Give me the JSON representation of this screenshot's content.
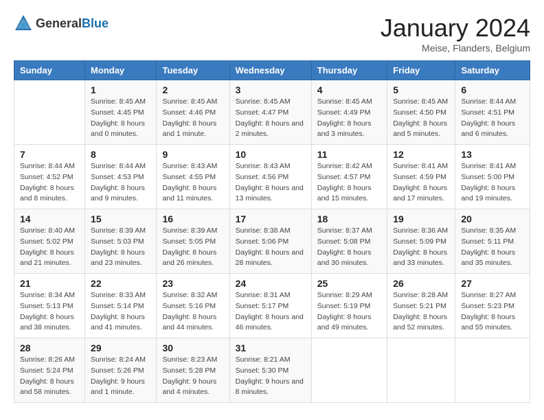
{
  "header": {
    "logo_general": "General",
    "logo_blue": "Blue",
    "month_title": "January 2024",
    "location": "Meise, Flanders, Belgium"
  },
  "days_of_week": [
    "Sunday",
    "Monday",
    "Tuesday",
    "Wednesday",
    "Thursday",
    "Friday",
    "Saturday"
  ],
  "weeks": [
    [
      {
        "day": "",
        "sunrise": "",
        "sunset": "",
        "daylight": ""
      },
      {
        "day": "1",
        "sunrise": "Sunrise: 8:45 AM",
        "sunset": "Sunset: 4:45 PM",
        "daylight": "Daylight: 8 hours and 0 minutes."
      },
      {
        "day": "2",
        "sunrise": "Sunrise: 8:45 AM",
        "sunset": "Sunset: 4:46 PM",
        "daylight": "Daylight: 8 hours and 1 minute."
      },
      {
        "day": "3",
        "sunrise": "Sunrise: 8:45 AM",
        "sunset": "Sunset: 4:47 PM",
        "daylight": "Daylight: 8 hours and 2 minutes."
      },
      {
        "day": "4",
        "sunrise": "Sunrise: 8:45 AM",
        "sunset": "Sunset: 4:49 PM",
        "daylight": "Daylight: 8 hours and 3 minutes."
      },
      {
        "day": "5",
        "sunrise": "Sunrise: 8:45 AM",
        "sunset": "Sunset: 4:50 PM",
        "daylight": "Daylight: 8 hours and 5 minutes."
      },
      {
        "day": "6",
        "sunrise": "Sunrise: 8:44 AM",
        "sunset": "Sunset: 4:51 PM",
        "daylight": "Daylight: 8 hours and 6 minutes."
      }
    ],
    [
      {
        "day": "7",
        "sunrise": "Sunrise: 8:44 AM",
        "sunset": "Sunset: 4:52 PM",
        "daylight": "Daylight: 8 hours and 8 minutes."
      },
      {
        "day": "8",
        "sunrise": "Sunrise: 8:44 AM",
        "sunset": "Sunset: 4:53 PM",
        "daylight": "Daylight: 8 hours and 9 minutes."
      },
      {
        "day": "9",
        "sunrise": "Sunrise: 8:43 AM",
        "sunset": "Sunset: 4:55 PM",
        "daylight": "Daylight: 8 hours and 11 minutes."
      },
      {
        "day": "10",
        "sunrise": "Sunrise: 8:43 AM",
        "sunset": "Sunset: 4:56 PM",
        "daylight": "Daylight: 8 hours and 13 minutes."
      },
      {
        "day": "11",
        "sunrise": "Sunrise: 8:42 AM",
        "sunset": "Sunset: 4:57 PM",
        "daylight": "Daylight: 8 hours and 15 minutes."
      },
      {
        "day": "12",
        "sunrise": "Sunrise: 8:41 AM",
        "sunset": "Sunset: 4:59 PM",
        "daylight": "Daylight: 8 hours and 17 minutes."
      },
      {
        "day": "13",
        "sunrise": "Sunrise: 8:41 AM",
        "sunset": "Sunset: 5:00 PM",
        "daylight": "Daylight: 8 hours and 19 minutes."
      }
    ],
    [
      {
        "day": "14",
        "sunrise": "Sunrise: 8:40 AM",
        "sunset": "Sunset: 5:02 PM",
        "daylight": "Daylight: 8 hours and 21 minutes."
      },
      {
        "day": "15",
        "sunrise": "Sunrise: 8:39 AM",
        "sunset": "Sunset: 5:03 PM",
        "daylight": "Daylight: 8 hours and 23 minutes."
      },
      {
        "day": "16",
        "sunrise": "Sunrise: 8:39 AM",
        "sunset": "Sunset: 5:05 PM",
        "daylight": "Daylight: 8 hours and 26 minutes."
      },
      {
        "day": "17",
        "sunrise": "Sunrise: 8:38 AM",
        "sunset": "Sunset: 5:06 PM",
        "daylight": "Daylight: 8 hours and 28 minutes."
      },
      {
        "day": "18",
        "sunrise": "Sunrise: 8:37 AM",
        "sunset": "Sunset: 5:08 PM",
        "daylight": "Daylight: 8 hours and 30 minutes."
      },
      {
        "day": "19",
        "sunrise": "Sunrise: 8:36 AM",
        "sunset": "Sunset: 5:09 PM",
        "daylight": "Daylight: 8 hours and 33 minutes."
      },
      {
        "day": "20",
        "sunrise": "Sunrise: 8:35 AM",
        "sunset": "Sunset: 5:11 PM",
        "daylight": "Daylight: 8 hours and 35 minutes."
      }
    ],
    [
      {
        "day": "21",
        "sunrise": "Sunrise: 8:34 AM",
        "sunset": "Sunset: 5:13 PM",
        "daylight": "Daylight: 8 hours and 38 minutes."
      },
      {
        "day": "22",
        "sunrise": "Sunrise: 8:33 AM",
        "sunset": "Sunset: 5:14 PM",
        "daylight": "Daylight: 8 hours and 41 minutes."
      },
      {
        "day": "23",
        "sunrise": "Sunrise: 8:32 AM",
        "sunset": "Sunset: 5:16 PM",
        "daylight": "Daylight: 8 hours and 44 minutes."
      },
      {
        "day": "24",
        "sunrise": "Sunrise: 8:31 AM",
        "sunset": "Sunset: 5:17 PM",
        "daylight": "Daylight: 8 hours and 46 minutes."
      },
      {
        "day": "25",
        "sunrise": "Sunrise: 8:29 AM",
        "sunset": "Sunset: 5:19 PM",
        "daylight": "Daylight: 8 hours and 49 minutes."
      },
      {
        "day": "26",
        "sunrise": "Sunrise: 8:28 AM",
        "sunset": "Sunset: 5:21 PM",
        "daylight": "Daylight: 8 hours and 52 minutes."
      },
      {
        "day": "27",
        "sunrise": "Sunrise: 8:27 AM",
        "sunset": "Sunset: 5:23 PM",
        "daylight": "Daylight: 8 hours and 55 minutes."
      }
    ],
    [
      {
        "day": "28",
        "sunrise": "Sunrise: 8:26 AM",
        "sunset": "Sunset: 5:24 PM",
        "daylight": "Daylight: 8 hours and 58 minutes."
      },
      {
        "day": "29",
        "sunrise": "Sunrise: 8:24 AM",
        "sunset": "Sunset: 5:26 PM",
        "daylight": "Daylight: 9 hours and 1 minute."
      },
      {
        "day": "30",
        "sunrise": "Sunrise: 8:23 AM",
        "sunset": "Sunset: 5:28 PM",
        "daylight": "Daylight: 9 hours and 4 minutes."
      },
      {
        "day": "31",
        "sunrise": "Sunrise: 8:21 AM",
        "sunset": "Sunset: 5:30 PM",
        "daylight": "Daylight: 9 hours and 8 minutes."
      },
      {
        "day": "",
        "sunrise": "",
        "sunset": "",
        "daylight": ""
      },
      {
        "day": "",
        "sunrise": "",
        "sunset": "",
        "daylight": ""
      },
      {
        "day": "",
        "sunrise": "",
        "sunset": "",
        "daylight": ""
      }
    ]
  ]
}
